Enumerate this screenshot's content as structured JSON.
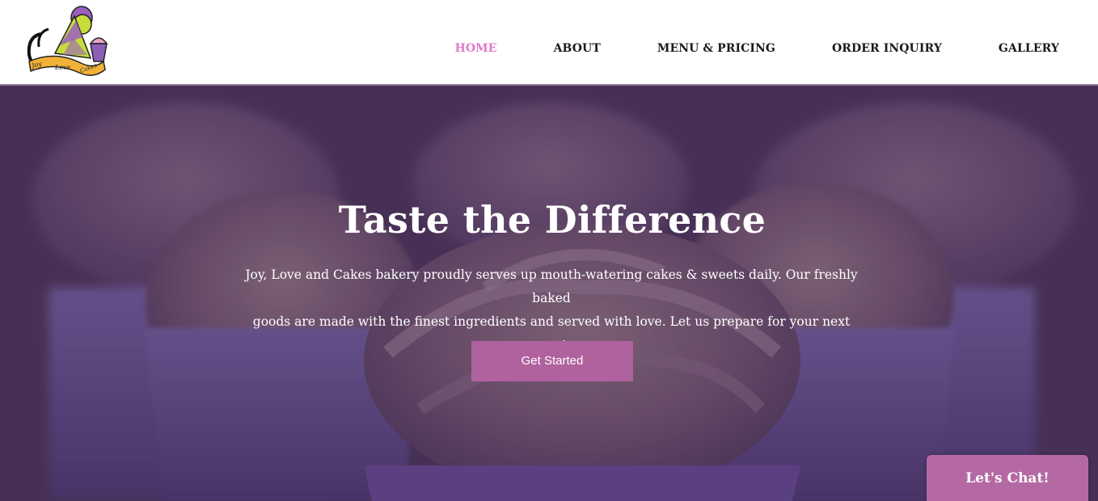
{
  "brand": {
    "logo_text": [
      "Joy",
      "Love",
      "Cakes"
    ]
  },
  "nav": {
    "items": [
      {
        "label": "HOME",
        "active": true
      },
      {
        "label": "ABOUT",
        "active": false
      },
      {
        "label": "MENU & PRICING",
        "active": false
      },
      {
        "label": "ORDER INQUIRY",
        "active": false
      },
      {
        "label": "GALLERY",
        "active": false
      }
    ]
  },
  "hero": {
    "title": "Taste the Difference",
    "subtitle_line1": "Joy, Love and Cakes bakery proudly serves up mouth-watering cakes & sweets daily. Our freshly baked",
    "subtitle_line2": "goods are made with the finest ingredients and served with love. Let us prepare for your next event.",
    "cta_label": "Get Started",
    "background_image": "purple-frosted-cupcakes"
  },
  "chat": {
    "label": "Let's Chat!"
  },
  "colors": {
    "nav_active": "#e07ac8",
    "nav_text": "#1a1a1a",
    "cta_bg": "#b0629e",
    "chat_bg": "#b569a4",
    "hero_overlay": "#4a3456",
    "header_rule": "#8d7b93"
  }
}
